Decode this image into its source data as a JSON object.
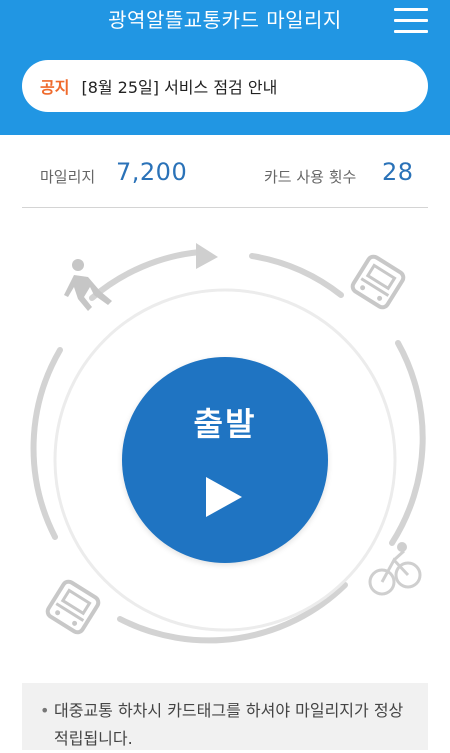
{
  "header": {
    "title": "광역알뜰교통카드 마일리지",
    "menu_icon": "hamburger-menu-icon"
  },
  "notice": {
    "label": "공지",
    "text": "[8월 25일] 서비스 점검 안내"
  },
  "stats": {
    "mileage_label": "마일리지",
    "mileage_value": "7,200",
    "usage_label": "카드 사용 횟수",
    "usage_value": "28"
  },
  "dial": {
    "start_label": "출발",
    "play_icon": "play-icon",
    "icons": [
      "walking-person-icon",
      "bus-icon",
      "bicycle-icon",
      "bus-icon"
    ]
  },
  "info": {
    "bullet": "•",
    "text": "대중교통 하차시 카드태그를 하셔야 마일리지가 정상 적립됩니다."
  },
  "colors": {
    "header_bg": "#2196e3",
    "accent_blue": "#1f74c2",
    "notice_label": "#ef6a2c",
    "ring": "#d3d3d3"
  }
}
